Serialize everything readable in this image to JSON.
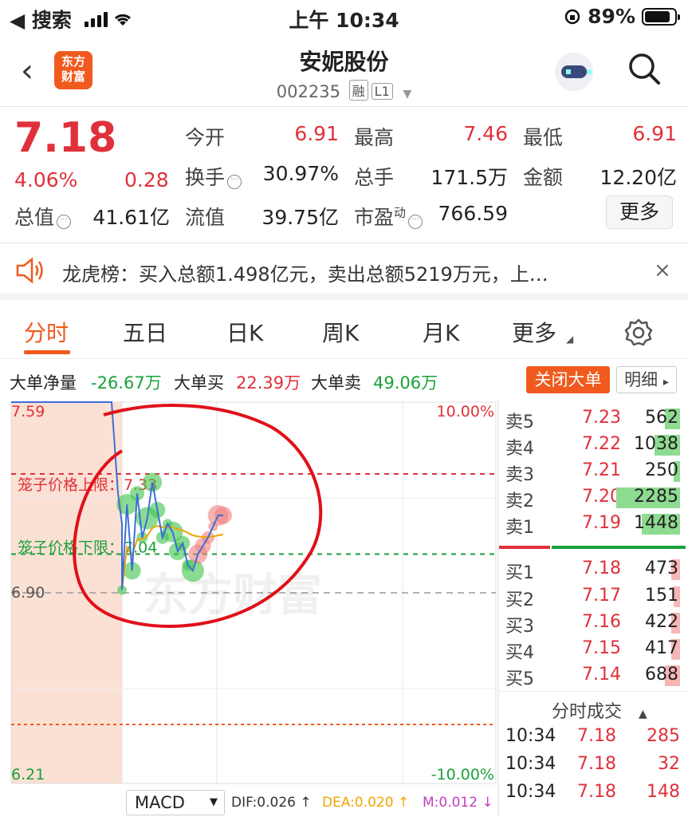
{
  "status_bar": {
    "back_app": "◀ 搜索",
    "time": "上午 10:34",
    "battery": "89%"
  },
  "header": {
    "logo_text_1": "东方",
    "logo_text_2": "财富",
    "stock_name": "安妮股份",
    "stock_code": "002235",
    "tag_margin": "融",
    "tag_level": "L1"
  },
  "quote": {
    "price": "7.18",
    "change_pct": "4.06%",
    "change": "0.28",
    "open_label": "今开",
    "open": "6.91",
    "high_label": "最高",
    "high": "7.46",
    "low_label": "最低",
    "low": "6.91",
    "turnover_label": "换手",
    "turnover": "30.97%",
    "volume_label": "总手",
    "volume": "171.5万",
    "amount_label": "金额",
    "amount": "12.20亿",
    "mktcap_label": "总值",
    "mktcap": "41.61亿",
    "float_label": "流值",
    "float": "39.75亿",
    "pe_label": "市盈",
    "pe_sup": "动",
    "pe": "766.59",
    "more_label": "更多"
  },
  "notice": {
    "text": "龙虎榜：买入总额1.498亿元，卖出总额5219万元，上…",
    "close": "×"
  },
  "tabs": [
    "分时",
    "五日",
    "日K",
    "周K",
    "月K",
    "更多"
  ],
  "big_order": {
    "net_label": "大单净量",
    "net": "-26.67万",
    "buy_label": "大单买",
    "buy": "22.39万",
    "sell_label": "大单卖",
    "sell": "49.06万",
    "close_btn": "关闭大单",
    "detail_btn": "明细"
  },
  "chart": {
    "y_top": "7.59",
    "y_mid": "6.90",
    "y_bottom": "6.21",
    "pct_top": "10.00%",
    "pct_bottom": "-10.00%",
    "upper_limit_label": "笼子价格上限：7.33",
    "lower_limit_label": "笼子价格下限：7.04",
    "watermark": "东方财富"
  },
  "chart_data": {
    "type": "line",
    "title": "",
    "ylim": [
      6.21,
      7.59
    ],
    "reference": 6.9,
    "cage_upper": 7.33,
    "cage_lower": 7.04,
    "series": [
      {
        "x": [
          0,
          1,
          2,
          3,
          4,
          5,
          6,
          7,
          8,
          9,
          10,
          11,
          12,
          13,
          14,
          15,
          16,
          17,
          18,
          19,
          20
        ],
        "y": [
          6.91,
          7.22,
          6.98,
          7.26,
          7.1,
          7.17,
          7.3,
          7.2,
          7.1,
          7.15,
          7.12,
          7.05,
          7.08,
          7.0,
          6.98,
          7.04,
          7.07,
          7.1,
          7.14,
          7.18,
          7.18
        ]
      }
    ]
  },
  "order_book": {
    "asks": [
      {
        "label": "卖5",
        "price": "7.23",
        "vol": "562",
        "frac": 0.12
      },
      {
        "label": "卖4",
        "price": "7.22",
        "vol": "1038",
        "frac": 0.2
      },
      {
        "label": "卖3",
        "price": "7.21",
        "vol": "250",
        "frac": 0.05
      },
      {
        "label": "卖2",
        "price": "7.20",
        "vol": "2285",
        "frac": 0.5
      },
      {
        "label": "卖1",
        "price": "7.19",
        "vol": "1448",
        "frac": 0.3
      }
    ],
    "bids": [
      {
        "label": "买1",
        "price": "7.18",
        "vol": "473",
        "frac": 0.07
      },
      {
        "label": "买2",
        "price": "7.17",
        "vol": "151",
        "frac": 0.03
      },
      {
        "label": "买3",
        "price": "7.16",
        "vol": "422",
        "frac": 0.07
      },
      {
        "label": "买4",
        "price": "7.15",
        "vol": "417",
        "frac": 0.07
      },
      {
        "label": "买5",
        "price": "7.14",
        "vol": "688",
        "frac": 0.12
      }
    ]
  },
  "ticks": {
    "title": "分时成交",
    "rows": [
      {
        "time": "10:34",
        "price": "7.18",
        "vol": "285"
      },
      {
        "time": "10:34",
        "price": "7.18",
        "vol": "32"
      },
      {
        "time": "10:34",
        "price": "7.18",
        "vol": "148"
      }
    ]
  },
  "indicator": {
    "name": "MACD",
    "dif": "DIF:0.026 ↑",
    "dea": "DEA:0.020 ↑",
    "m": "M:0.012 ↓"
  },
  "colors": {
    "red": "#e0313a",
    "green": "#1aa13a",
    "brand": "#f05a1e",
    "price_line": "#3c6fd8"
  }
}
